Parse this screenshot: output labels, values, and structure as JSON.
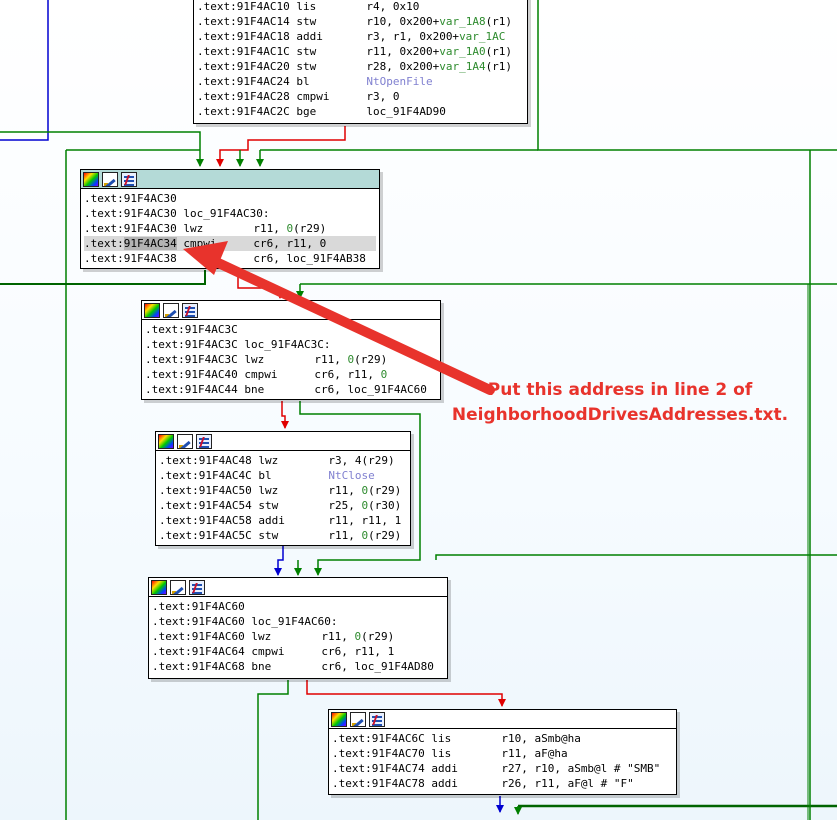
{
  "nodes": {
    "n1": {
      "lines": [
        {
          "addr": ".text:91F4AC10",
          "mn": "lis",
          "parts": [
            {
              "t": "r4, 0x10"
            }
          ]
        },
        {
          "addr": ".text:91F4AC14",
          "mn": "stw",
          "parts": [
            {
              "t": "r10, 0x200+"
            },
            {
              "t": "var_1A8",
              "c": "sym"
            },
            {
              "t": "(r1)"
            }
          ]
        },
        {
          "addr": ".text:91F4AC18",
          "mn": "addi",
          "parts": [
            {
              "t": "r3, r1, 0x200+"
            },
            {
              "t": "var_1AC",
              "c": "sym"
            }
          ]
        },
        {
          "addr": ".text:91F4AC1C",
          "mn": "stw",
          "parts": [
            {
              "t": "r11, 0x200+"
            },
            {
              "t": "var_1A0",
              "c": "sym"
            },
            {
              "t": "(r1)"
            }
          ]
        },
        {
          "addr": ".text:91F4AC20",
          "mn": "stw",
          "parts": [
            {
              "t": "r28, 0x200+"
            },
            {
              "t": "var_1A4",
              "c": "sym"
            },
            {
              "t": "(r1)"
            }
          ]
        },
        {
          "addr": ".text:91F4AC24",
          "mn": "bl",
          "parts": [
            {
              "t": "NtOpenFile",
              "c": "ext"
            }
          ]
        },
        {
          "addr": ".text:91F4AC28",
          "mn": "cmpwi",
          "parts": [
            {
              "t": "r3, 0"
            }
          ]
        },
        {
          "addr": ".text:91F4AC2C",
          "mn": "bge",
          "parts": [
            {
              "t": "loc_91F4AD90"
            }
          ]
        }
      ]
    },
    "n2": {
      "lines": [
        {
          "addr": ".text:91F4AC30",
          "mn": "",
          "parts": []
        },
        {
          "addr": ".text:91F4AC30",
          "mn": "loc_91F4AC30:",
          "parts": []
        },
        {
          "addr": ".text:91F4AC30",
          "mn": "lwz",
          "parts": [
            {
              "t": "r11, "
            },
            {
              "t": "0",
              "c": "sym"
            },
            {
              "t": "(r29)"
            }
          ]
        },
        {
          "addr": ".text:91F4AC34",
          "mn": "cmpwi",
          "parts": [
            {
              "t": "cr6, r11, 0"
            }
          ]
        },
        {
          "addr": ".text:91F4AC38",
          "mn": "",
          "parts": [
            {
              "t": "cr6, loc_91F4AB38"
            }
          ]
        }
      ]
    },
    "n3": {
      "lines": [
        {
          "addr": ".text:91F4AC3C",
          "mn": "",
          "parts": []
        },
        {
          "addr": ".text:91F4AC3C",
          "mn": "loc_91F4AC3C:",
          "parts": []
        },
        {
          "addr": ".text:91F4AC3C",
          "mn": "lwz",
          "parts": [
            {
              "t": "r11, "
            },
            {
              "t": "0",
              "c": "sym"
            },
            {
              "t": "(r29)"
            }
          ]
        },
        {
          "addr": ".text:91F4AC40",
          "mn": "cmpwi",
          "parts": [
            {
              "t": "cr6, r11, "
            },
            {
              "t": "0",
              "c": "sym"
            }
          ]
        },
        {
          "addr": ".text:91F4AC44",
          "mn": "bne",
          "parts": [
            {
              "t": "cr6, loc_91F4AC60"
            }
          ]
        }
      ]
    },
    "n4": {
      "lines": [
        {
          "addr": ".text:91F4AC48",
          "mn": "lwz",
          "parts": [
            {
              "t": "r3, 4(r29)"
            }
          ]
        },
        {
          "addr": ".text:91F4AC4C",
          "mn": "bl",
          "parts": [
            {
              "t": "NtClose",
              "c": "ext"
            }
          ]
        },
        {
          "addr": ".text:91F4AC50",
          "mn": "lwz",
          "parts": [
            {
              "t": "r11, "
            },
            {
              "t": "0",
              "c": "sym"
            },
            {
              "t": "(r29)"
            }
          ]
        },
        {
          "addr": ".text:91F4AC54",
          "mn": "stw",
          "parts": [
            {
              "t": "r25, "
            },
            {
              "t": "0",
              "c": "sym"
            },
            {
              "t": "(r30)"
            }
          ]
        },
        {
          "addr": ".text:91F4AC58",
          "mn": "addi",
          "parts": [
            {
              "t": "r11, r11, 1"
            }
          ]
        },
        {
          "addr": ".text:91F4AC5C",
          "mn": "stw",
          "parts": [
            {
              "t": "r11, "
            },
            {
              "t": "0",
              "c": "sym"
            },
            {
              "t": "(r29)"
            }
          ]
        }
      ]
    },
    "n5": {
      "lines": [
        {
          "addr": ".text:91F4AC60",
          "mn": "",
          "parts": []
        },
        {
          "addr": ".text:91F4AC60",
          "mn": "loc_91F4AC60:",
          "parts": []
        },
        {
          "addr": ".text:91F4AC60",
          "mn": "lwz",
          "parts": [
            {
              "t": "r11, "
            },
            {
              "t": "0",
              "c": "sym"
            },
            {
              "t": "(r29)"
            }
          ]
        },
        {
          "addr": ".text:91F4AC64",
          "mn": "cmpwi",
          "parts": [
            {
              "t": "cr6, r11, 1"
            }
          ]
        },
        {
          "addr": ".text:91F4AC68",
          "mn": "bne",
          "parts": [
            {
              "t": "cr6, loc_91F4AD80"
            }
          ]
        }
      ]
    },
    "n6": {
      "lines": [
        {
          "addr": ".text:91F4AC6C",
          "mn": "lis",
          "parts": [
            {
              "t": "r10, aSmb@ha"
            }
          ]
        },
        {
          "addr": ".text:91F4AC70",
          "mn": "lis",
          "parts": [
            {
              "t": "r11, aF@ha"
            }
          ]
        },
        {
          "addr": ".text:91F4AC74",
          "mn": "addi",
          "parts": [
            {
              "t": "r27, r10, aSmb@l # \"SMB\""
            }
          ]
        },
        {
          "addr": ".text:91F4AC78",
          "mn": "addi",
          "parts": [
            {
              "t": "r26, r11, aF@l # \"F\""
            }
          ]
        }
      ]
    }
  },
  "annotation": {
    "line1": "Put this address in line 2 of",
    "line2": "NeighborhoodDrivesAddresses.txt."
  },
  "colors": {
    "edge_true": "#008000",
    "edge_false": "#e00000",
    "edge_unconditional": "#0000d0",
    "annotation": "#e8332c",
    "selected_header": "#b4dad7"
  }
}
